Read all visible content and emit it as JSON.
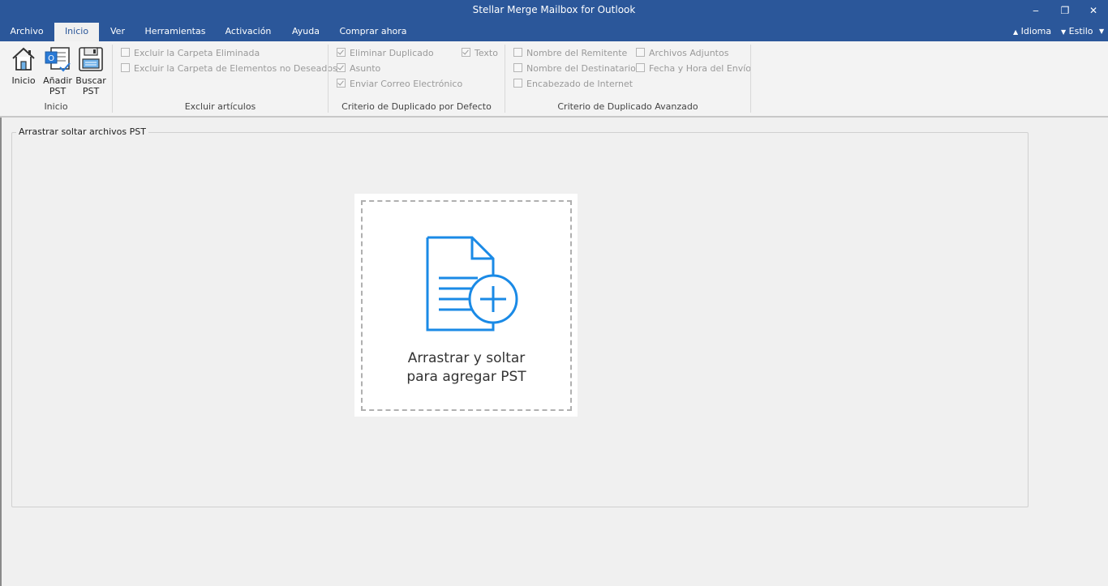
{
  "window": {
    "title": "Stellar Merge Mailbox for Outlook"
  },
  "controls": {
    "minimize": "‒",
    "restore": "❐",
    "close": "✕"
  },
  "menu": {
    "tabs": [
      "Archivo",
      "Inicio",
      "Ver",
      "Herramientas",
      "Activación",
      "Ayuda",
      "Comprar ahora"
    ],
    "active_index": 1,
    "idioma": "Idioma",
    "estilo": "Estilo"
  },
  "ribbon": {
    "inicio": {
      "label": "Inicio",
      "buttons": {
        "inicio": "Inicio",
        "anadir_l1": "Añadir",
        "anadir_l2": "PST",
        "buscar_l1": "Buscar",
        "buscar_l2": "PST"
      }
    },
    "excluir": {
      "label": "Excluir artículos",
      "items": [
        "Excluir la Carpeta Eliminada",
        "Excluir la Carpeta de Elementos no Deseados"
      ]
    },
    "defecto": {
      "label": "Criterio de Duplicado por Defecto",
      "items": [
        "Eliminar Duplicado",
        "Asunto",
        "Enviar Correo Electrónico",
        "Texto"
      ]
    },
    "avanzado": {
      "label": "Criterio de Duplicado Avanzado",
      "items": [
        "Nombre del Remitente",
        "Nombre del Destinatario",
        "Encabezado de Internet",
        "Archivos Adjuntos",
        "Fecha y Hora del Envío"
      ]
    }
  },
  "main": {
    "legend": "Arrastrar  soltar archivos PST",
    "drop_line1": "Arrastrar y soltar",
    "drop_line2": "para agregar PST"
  },
  "colors": {
    "titlebar": "#2b579a",
    "accent": "#1a8ae6"
  }
}
